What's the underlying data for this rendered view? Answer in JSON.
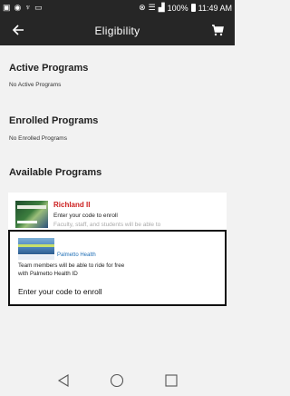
{
  "status_bar": {
    "signal_text": "100%",
    "time": "11:49 AM"
  },
  "app_bar": {
    "title": "Eligibility",
    "back_icon": "arrow-left-icon",
    "cart_icon": "cart-icon"
  },
  "sections": {
    "active": {
      "title": "Active Programs",
      "note": "No Active Programs"
    },
    "enrolled": {
      "title": "Enrolled Programs",
      "note": "No Enrolled Programs"
    },
    "available": {
      "title": "Available Programs"
    }
  },
  "programs": [
    {
      "name": "Richland II",
      "line1": "Enter your code to enroll",
      "line2": "Faculty, staff, and students will be able to"
    },
    {
      "name": "Palmetto Health",
      "line1": "Team members will be able to ride for free",
      "line2": "with Palmetto Health ID",
      "cta": "Enter your code to enroll"
    }
  ],
  "nav": {
    "back_icon": "triangle-back-icon",
    "home_icon": "circle-home-icon",
    "recents_icon": "square-recents-icon"
  },
  "colors": {
    "app_bar_bg": "#262626",
    "accent_red": "#cc1e1e",
    "accent_blue": "#1f6fb6",
    "background": "#f2f2f2"
  }
}
